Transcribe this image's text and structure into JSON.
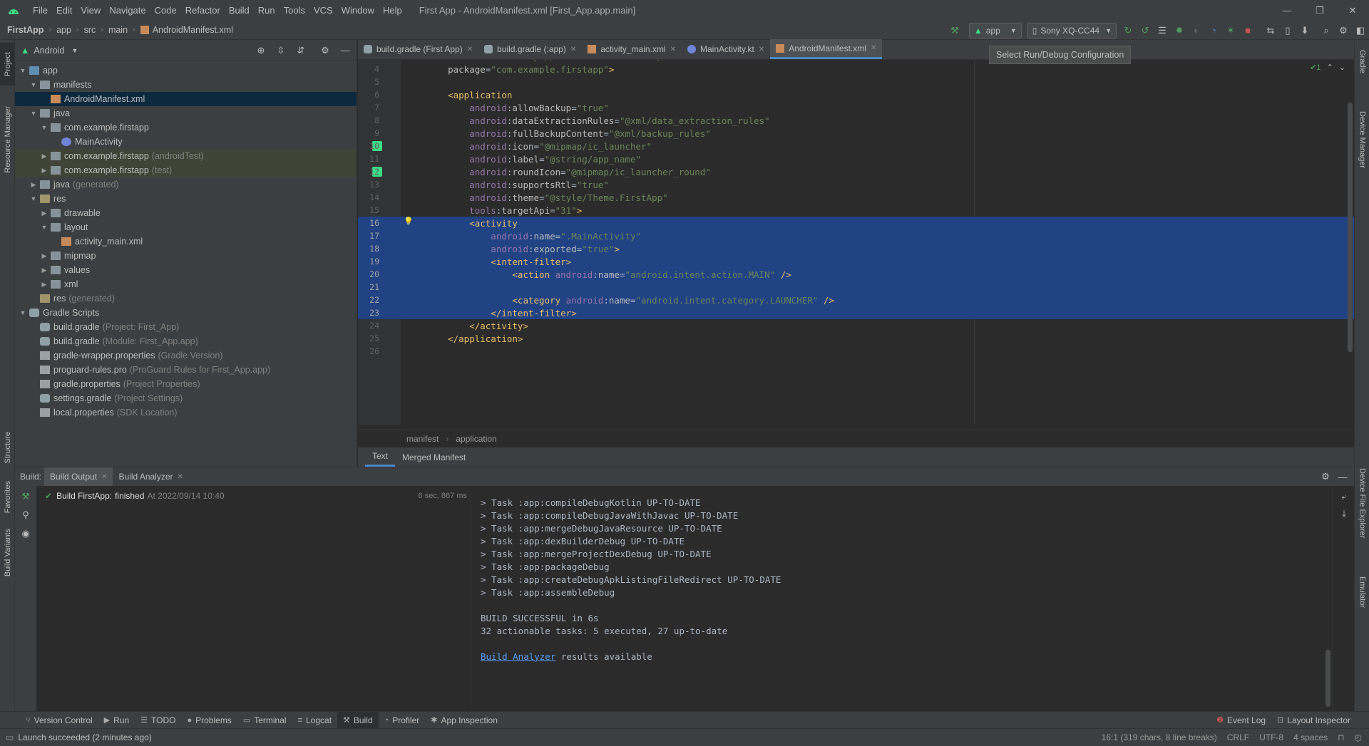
{
  "window": {
    "title": "First App - AndroidManifest.xml [First_App.app.main]",
    "menu": [
      "File",
      "Edit",
      "View",
      "Navigate",
      "Code",
      "Refactor",
      "Build",
      "Run",
      "Tools",
      "VCS",
      "Window",
      "Help"
    ],
    "controls": [
      "—",
      "❐",
      "✕"
    ]
  },
  "breadcrumb": [
    "FirstApp",
    "app",
    "src",
    "main",
    "AndroidManifest.xml"
  ],
  "toolbar": {
    "run_config": "app",
    "device": "Sony XQ-CC44",
    "tooltip": "Select Run/Debug Configuration"
  },
  "left_strip": [
    "Project",
    "Resource Manager",
    "Structure",
    "Favorites",
    "Build Variants"
  ],
  "right_strip": [
    "Gradle",
    "Device Manager",
    "Device File Explorer",
    "Emulator"
  ],
  "project": {
    "view_mode": "Android",
    "tree": [
      {
        "label": "app",
        "dim": "",
        "level": 0,
        "arrow": "▼",
        "icon": "folder blue",
        "cls": ""
      },
      {
        "label": "manifests",
        "dim": "",
        "level": 1,
        "arrow": "▼",
        "icon": "folder",
        "cls": ""
      },
      {
        "label": "AndroidManifest.xml",
        "dim": "",
        "level": 2,
        "arrow": "",
        "icon": "xml",
        "cls": "sel"
      },
      {
        "label": "java",
        "dim": "",
        "level": 1,
        "arrow": "▼",
        "icon": "folder",
        "cls": ""
      },
      {
        "label": "com.example.firstapp",
        "dim": "",
        "level": 2,
        "arrow": "▼",
        "icon": "pkg",
        "cls": ""
      },
      {
        "label": "MainActivity",
        "dim": "",
        "level": 3,
        "arrow": "",
        "icon": "kt",
        "cls": ""
      },
      {
        "label": "com.example.firstapp",
        "dim": "(androidTest)",
        "level": 2,
        "arrow": "▶",
        "icon": "pkg",
        "cls": "test"
      },
      {
        "label": "com.example.firstapp",
        "dim": "(test)",
        "level": 2,
        "arrow": "▶",
        "icon": "pkg",
        "cls": "test"
      },
      {
        "label": "java",
        "dim": "(generated)",
        "level": 1,
        "arrow": "▶",
        "icon": "folder",
        "cls": ""
      },
      {
        "label": "res",
        "dim": "",
        "level": 1,
        "arrow": "▼",
        "icon": "folder res",
        "cls": ""
      },
      {
        "label": "drawable",
        "dim": "",
        "level": 2,
        "arrow": "▶",
        "icon": "folder",
        "cls": ""
      },
      {
        "label": "layout",
        "dim": "",
        "level": 2,
        "arrow": "▼",
        "icon": "folder",
        "cls": ""
      },
      {
        "label": "activity_main.xml",
        "dim": "",
        "level": 3,
        "arrow": "",
        "icon": "xml",
        "cls": ""
      },
      {
        "label": "mipmap",
        "dim": "",
        "level": 2,
        "arrow": "▶",
        "icon": "folder",
        "cls": ""
      },
      {
        "label": "values",
        "dim": "",
        "level": 2,
        "arrow": "▶",
        "icon": "folder",
        "cls": ""
      },
      {
        "label": "xml",
        "dim": "",
        "level": 2,
        "arrow": "▶",
        "icon": "folder",
        "cls": ""
      },
      {
        "label": "res",
        "dim": "(generated)",
        "level": 1,
        "arrow": "",
        "icon": "folder res",
        "cls": ""
      },
      {
        "label": "Gradle Scripts",
        "dim": "",
        "level": 0,
        "arrow": "▼",
        "icon": "gradle",
        "cls": ""
      },
      {
        "label": "build.gradle",
        "dim": "(Project: First_App)",
        "level": 1,
        "arrow": "",
        "icon": "gradle",
        "cls": ""
      },
      {
        "label": "build.gradle",
        "dim": "(Module: First_App.app)",
        "level": 1,
        "arrow": "",
        "icon": "gradle",
        "cls": ""
      },
      {
        "label": "gradle-wrapper.properties",
        "dim": "(Gradle Version)",
        "level": 1,
        "arrow": "",
        "icon": "file",
        "cls": ""
      },
      {
        "label": "proguard-rules.pro",
        "dim": "(ProGuard Rules for First_App.app)",
        "level": 1,
        "arrow": "",
        "icon": "file",
        "cls": ""
      },
      {
        "label": "gradle.properties",
        "dim": "(Project Properties)",
        "level": 1,
        "arrow": "",
        "icon": "file",
        "cls": ""
      },
      {
        "label": "settings.gradle",
        "dim": "(Project Settings)",
        "level": 1,
        "arrow": "",
        "icon": "gradle",
        "cls": ""
      },
      {
        "label": "local.properties",
        "dim": "(SDK Location)",
        "level": 1,
        "arrow": "",
        "icon": "file",
        "cls": ""
      }
    ]
  },
  "editor_tabs": [
    {
      "label": "build.gradle (First App)",
      "icon": "gradle",
      "active": false
    },
    {
      "label": "build.gradle (:app)",
      "icon": "gradle",
      "active": false
    },
    {
      "label": "activity_main.xml",
      "icon": "xml",
      "active": false
    },
    {
      "label": "MainActivity.kt",
      "icon": "kt",
      "active": false
    },
    {
      "label": "AndroidManifest.xml",
      "icon": "xml",
      "active": true
    }
  ],
  "inspection": "✔1",
  "code_lines": [
    {
      "n": "3",
      "sel": false,
      "t": [
        [
          "t-ns",
          "    xmlns:"
        ],
        [
          "t-attr",
          "tools"
        ],
        [
          "t-plain",
          "="
        ],
        [
          "t-val",
          "\"http://schemas.android.com/tools\""
        ]
      ]
    },
    {
      "n": "4",
      "sel": false,
      "t": [
        [
          "t-attr",
          "    package"
        ],
        [
          "t-plain",
          "="
        ],
        [
          "t-val",
          "\"com.example.firstapp\""
        ],
        [
          "t-tag",
          ">"
        ]
      ]
    },
    {
      "n": "5",
      "sel": false,
      "t": []
    },
    {
      "n": "6",
      "sel": false,
      "t": [
        [
          "t-tag",
          "    <application"
        ]
      ]
    },
    {
      "n": "7",
      "sel": false,
      "t": [
        [
          "t-ns",
          "        android"
        ],
        [
          "t-plain",
          ":"
        ],
        [
          "t-attr",
          "allowBackup"
        ],
        [
          "t-plain",
          "="
        ],
        [
          "t-val",
          "\"true\""
        ]
      ]
    },
    {
      "n": "8",
      "sel": false,
      "t": [
        [
          "t-ns",
          "        android"
        ],
        [
          "t-plain",
          ":"
        ],
        [
          "t-attr",
          "dataExtractionRules"
        ],
        [
          "t-plain",
          "="
        ],
        [
          "t-val",
          "\"@xml/data_extraction_rules\""
        ]
      ]
    },
    {
      "n": "9",
      "sel": false,
      "t": [
        [
          "t-ns",
          "        android"
        ],
        [
          "t-plain",
          ":"
        ],
        [
          "t-attr",
          "fullBackupContent"
        ],
        [
          "t-plain",
          "="
        ],
        [
          "t-val",
          "\"@xml/backup_rules\""
        ]
      ]
    },
    {
      "n": "10",
      "sel": false,
      "t": [
        [
          "t-ns",
          "        android"
        ],
        [
          "t-plain",
          ":"
        ],
        [
          "t-attr",
          "icon"
        ],
        [
          "t-plain",
          "="
        ],
        [
          "t-val",
          "\"@mipmap/ic_launcher\""
        ]
      ]
    },
    {
      "n": "11",
      "sel": false,
      "t": [
        [
          "t-ns",
          "        android"
        ],
        [
          "t-plain",
          ":"
        ],
        [
          "t-attr",
          "label"
        ],
        [
          "t-plain",
          "="
        ],
        [
          "t-val",
          "\"@string/app_name\""
        ]
      ]
    },
    {
      "n": "12",
      "sel": false,
      "t": [
        [
          "t-ns",
          "        android"
        ],
        [
          "t-plain",
          ":"
        ],
        [
          "t-attr",
          "roundIcon"
        ],
        [
          "t-plain",
          "="
        ],
        [
          "t-val",
          "\"@mipmap/ic_launcher_round\""
        ]
      ]
    },
    {
      "n": "13",
      "sel": false,
      "t": [
        [
          "t-ns",
          "        android"
        ],
        [
          "t-plain",
          ":"
        ],
        [
          "t-attr",
          "supportsRtl"
        ],
        [
          "t-plain",
          "="
        ],
        [
          "t-val",
          "\"true\""
        ]
      ]
    },
    {
      "n": "14",
      "sel": false,
      "t": [
        [
          "t-ns",
          "        android"
        ],
        [
          "t-plain",
          ":"
        ],
        [
          "t-attr",
          "theme"
        ],
        [
          "t-plain",
          "="
        ],
        [
          "t-val",
          "\"@style/Theme.FirstApp\""
        ]
      ]
    },
    {
      "n": "15",
      "sel": false,
      "t": [
        [
          "t-ns",
          "        tools"
        ],
        [
          "t-plain",
          ":"
        ],
        [
          "t-attr",
          "targetApi"
        ],
        [
          "t-plain",
          "="
        ],
        [
          "t-val",
          "\"31\""
        ],
        [
          "t-tag",
          ">"
        ]
      ]
    },
    {
      "n": "16",
      "sel": true,
      "t": [
        [
          "t-tag",
          "        <activity"
        ]
      ]
    },
    {
      "n": "17",
      "sel": true,
      "t": [
        [
          "t-ns",
          "            android"
        ],
        [
          "t-plain",
          ":"
        ],
        [
          "t-attr",
          "name"
        ],
        [
          "t-plain",
          "="
        ],
        [
          "t-val",
          "\".MainActivity\""
        ]
      ]
    },
    {
      "n": "18",
      "sel": true,
      "t": [
        [
          "t-ns",
          "            android"
        ],
        [
          "t-plain",
          ":"
        ],
        [
          "t-attr",
          "exported"
        ],
        [
          "t-plain",
          "="
        ],
        [
          "t-val",
          "\"true\""
        ],
        [
          "t-tag",
          ">"
        ]
      ]
    },
    {
      "n": "19",
      "sel": true,
      "t": [
        [
          "t-tag",
          "            <intent-filter>"
        ]
      ]
    },
    {
      "n": "20",
      "sel": true,
      "t": [
        [
          "t-tag",
          "                <action "
        ],
        [
          "t-ns",
          "android"
        ],
        [
          "t-plain",
          ":"
        ],
        [
          "t-attr",
          "name"
        ],
        [
          "t-plain",
          "="
        ],
        [
          "t-val",
          "\"android.intent.action.MAIN\""
        ],
        [
          "t-tag",
          " />"
        ]
      ]
    },
    {
      "n": "21",
      "sel": true,
      "t": []
    },
    {
      "n": "22",
      "sel": true,
      "t": [
        [
          "t-tag",
          "                <category "
        ],
        [
          "t-ns",
          "android"
        ],
        [
          "t-plain",
          ":"
        ],
        [
          "t-attr",
          "name"
        ],
        [
          "t-plain",
          "="
        ],
        [
          "t-val",
          "\"android.intent.category.LAUNCHER\""
        ],
        [
          "t-tag",
          " />"
        ]
      ]
    },
    {
      "n": "23",
      "sel": true,
      "t": [
        [
          "t-tag",
          "            </intent-filter>"
        ]
      ]
    },
    {
      "n": "24",
      "sel": false,
      "t": [
        [
          "t-tag",
          "        </activity>"
        ]
      ]
    },
    {
      "n": "25",
      "sel": false,
      "t": [
        [
          "t-tag",
          "    </application>"
        ]
      ]
    },
    {
      "n": "26",
      "sel": false,
      "t": []
    }
  ],
  "editor_breadcrumb": [
    "manifest",
    "application"
  ],
  "manifest_tabs": [
    "Text",
    "Merged Manifest"
  ],
  "build": {
    "label": "Build:",
    "tabs": [
      "Build Output",
      "Build Analyzer"
    ],
    "result": "Build FirstApp:",
    "result_status": "finished",
    "result_time": "At 2022/09/14 10:40",
    "duration": "6 sec, 867 ms",
    "output": [
      "> Task :app:compileDebugKotlin UP-TO-DATE",
      "> Task :app:compileDebugJavaWithJavac UP-TO-DATE",
      "> Task :app:mergeDebugJavaResource UP-TO-DATE",
      "> Task :app:dexBuilderDebug UP-TO-DATE",
      "> Task :app:mergeProjectDexDebug UP-TO-DATE",
      "> Task :app:packageDebug",
      "> Task :app:createDebugApkListingFileRedirect UP-TO-DATE",
      "> Task :app:assembleDebug",
      "",
      "BUILD SUCCESSFUL in 6s",
      "32 actionable tasks: 5 executed, 27 up-to-date",
      ""
    ],
    "analyzer_link": "Build Analyzer",
    "analyzer_text": " results available"
  },
  "tool_windows": [
    {
      "label": "Version Control",
      "icon": "⑂",
      "active": false
    },
    {
      "label": "Run",
      "icon": "▶",
      "active": false
    },
    {
      "label": "TODO",
      "icon": "☰",
      "active": false
    },
    {
      "label": "Problems",
      "icon": "●",
      "active": false
    },
    {
      "label": "Terminal",
      "icon": "▭",
      "active": false
    },
    {
      "label": "Logcat",
      "icon": "≡",
      "active": false
    },
    {
      "label": "Build",
      "icon": "⚒",
      "active": true
    },
    {
      "label": "Profiler",
      "icon": "◔",
      "active": false
    },
    {
      "label": "App Inspection",
      "icon": "✱",
      "active": false
    }
  ],
  "tool_windows_right": [
    {
      "label": "Event Log",
      "icon": "❷"
    },
    {
      "label": "Layout Inspector",
      "icon": "⊡"
    }
  ],
  "status": {
    "message": "Launch succeeded (2 minutes ago)",
    "position": "16:1 (319 chars, 8 line breaks)",
    "line_sep": "CRLF",
    "encoding": "UTF-8",
    "indent": "4 spaces"
  },
  "colors": {
    "accent": "#4a88c7",
    "selection": "#214283",
    "success": "#499c54"
  }
}
